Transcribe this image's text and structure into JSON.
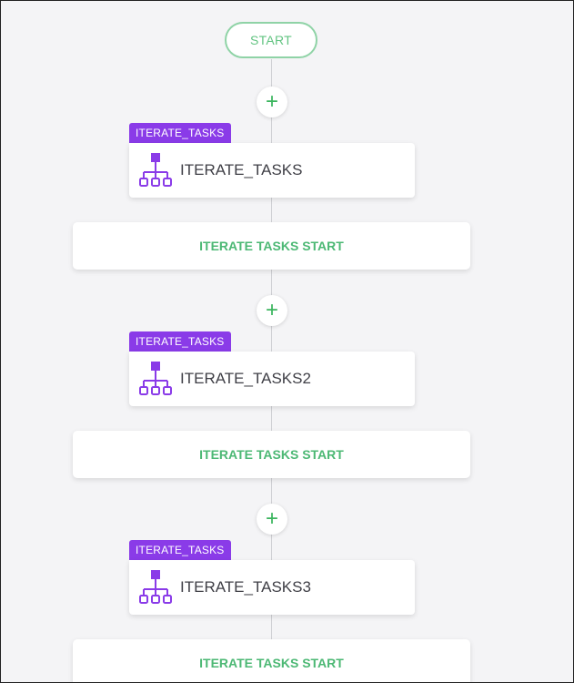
{
  "start": {
    "label": "START"
  },
  "add_icon": "plus-icon",
  "task_icon": "hierarchy-icon",
  "colors": {
    "accent_green": "#3bb55e",
    "badge_purple": "#8a3be8",
    "icon_purple": "#8a3be8"
  },
  "blocks": [
    {
      "badge": "ITERATE_TASKS",
      "name": "ITERATE_TASKS",
      "section": "ITERATE TASKS START"
    },
    {
      "badge": "ITERATE_TASKS",
      "name": "ITERATE_TASKS2",
      "section": "ITERATE TASKS START"
    },
    {
      "badge": "ITERATE_TASKS",
      "name": "ITERATE_TASKS3",
      "section": "ITERATE TASKS START"
    }
  ]
}
